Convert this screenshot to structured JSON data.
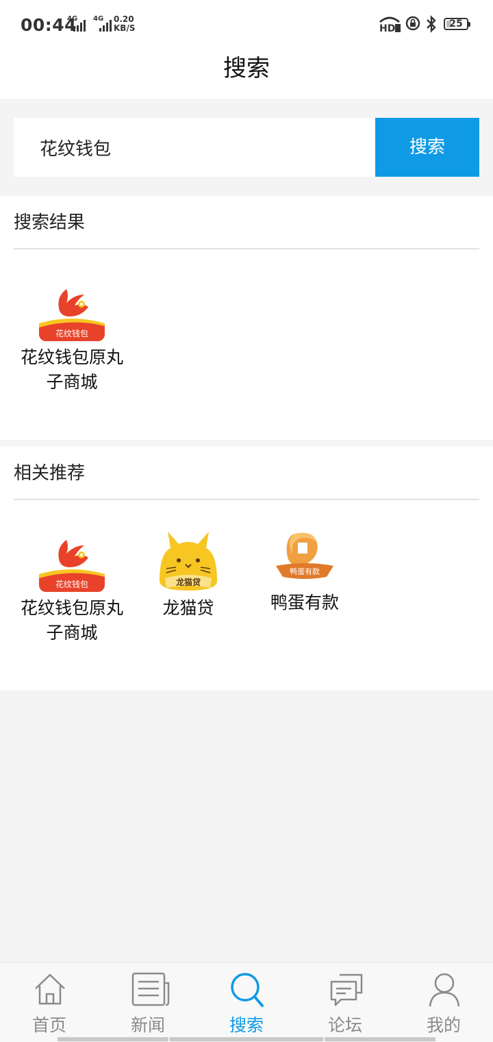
{
  "status_bar": {
    "time": "00:44",
    "net1": "4G",
    "net2": "4G",
    "speed_value": "0.20",
    "speed_unit": "KB/S",
    "battery": "25",
    "battery_level_percent": 25,
    "icons": [
      "hd-icon",
      "rotation-lock-icon",
      "bluetooth-icon",
      "battery-icon"
    ]
  },
  "header": {
    "title": "搜索"
  },
  "search": {
    "value": "花纹钱包",
    "button_label": "搜索"
  },
  "results": {
    "title": "搜索结果",
    "items": [
      {
        "name": "花纹钱包原丸子商城",
        "icon_label": "花纹钱包",
        "icon": "huawen-wallet-icon"
      }
    ]
  },
  "recommend": {
    "title": "相关推荐",
    "items": [
      {
        "name": "花纹钱包原丸子商城",
        "icon_label": "花纹钱包",
        "icon": "huawen-wallet-icon"
      },
      {
        "name": "龙猫贷",
        "icon_label": "龙猫贷",
        "icon": "longmao-loan-icon"
      },
      {
        "name": "鸭蛋有款",
        "icon_label": "鸭蛋有款",
        "icon": "yadan-youkuan-icon"
      }
    ]
  },
  "tabs": [
    {
      "label": "首页",
      "icon": "home-icon",
      "active": false
    },
    {
      "label": "新闻",
      "icon": "news-icon",
      "active": false
    },
    {
      "label": "搜索",
      "icon": "search-icon",
      "active": true
    },
    {
      "label": "论坛",
      "icon": "forum-icon",
      "active": false
    },
    {
      "label": "我的",
      "icon": "profile-icon",
      "active": false
    }
  ],
  "colors": {
    "accent": "#0f9ae6",
    "background": "#f4f4f4",
    "huawen_red": "#e8432a",
    "longmao_yellow": "#f7c623",
    "yadan_orange": "#f0a040"
  }
}
